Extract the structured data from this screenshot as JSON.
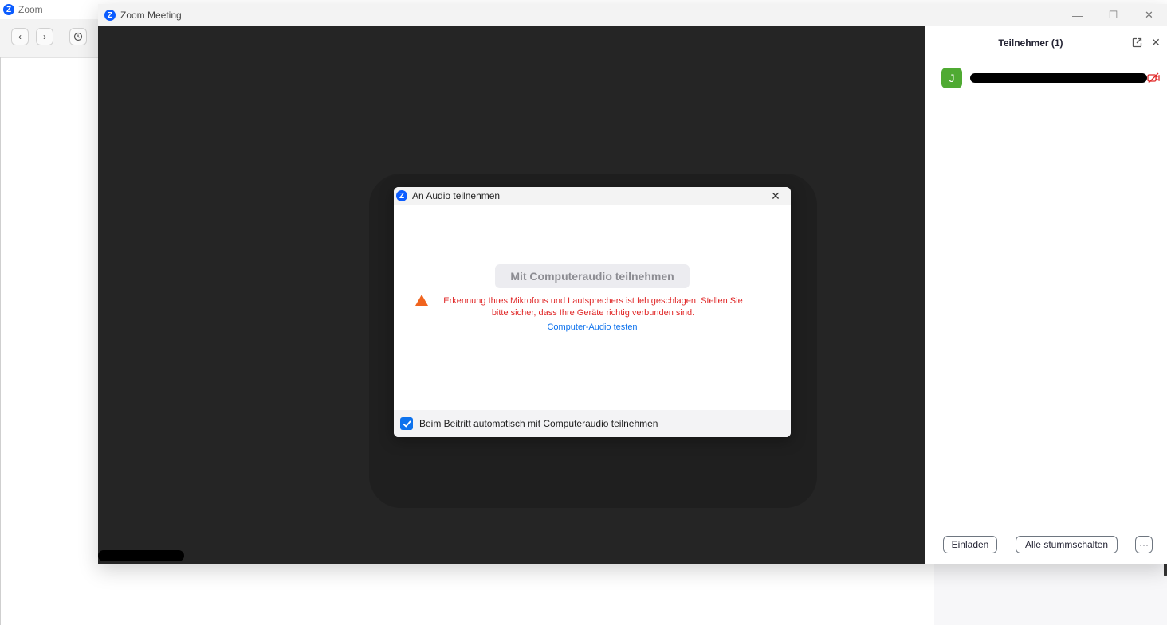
{
  "app": {
    "title": "Zoom"
  },
  "meeting": {
    "window_title": "Zoom Meeting"
  },
  "panel": {
    "title": "Teilnehmer (1)",
    "participant": {
      "initial": "J"
    },
    "invite_label": "Einladen",
    "mute_all_label": "Alle stummschalten",
    "more_label": "···"
  },
  "dialog": {
    "title": "An Audio teilnehmen",
    "join_button": "Mit Computeraudio teilnehmen",
    "error_text": "Erkennung Ihres Mikrofons und Lautsprechers ist fehlgeschlagen. Stellen Sie bitte sicher, dass Ihre Geräte richtig verbunden sind.",
    "test_link": "Computer-Audio testen",
    "auto_join_label": "Beim Beitritt automatisch mit Computeraudio teilnehmen",
    "auto_join_checked": true
  },
  "colors": {
    "brand": "#0b5cff",
    "link": "#0e72ed",
    "error": "#e02828",
    "warning": "#f0641e",
    "avatar": "#4faa32"
  }
}
